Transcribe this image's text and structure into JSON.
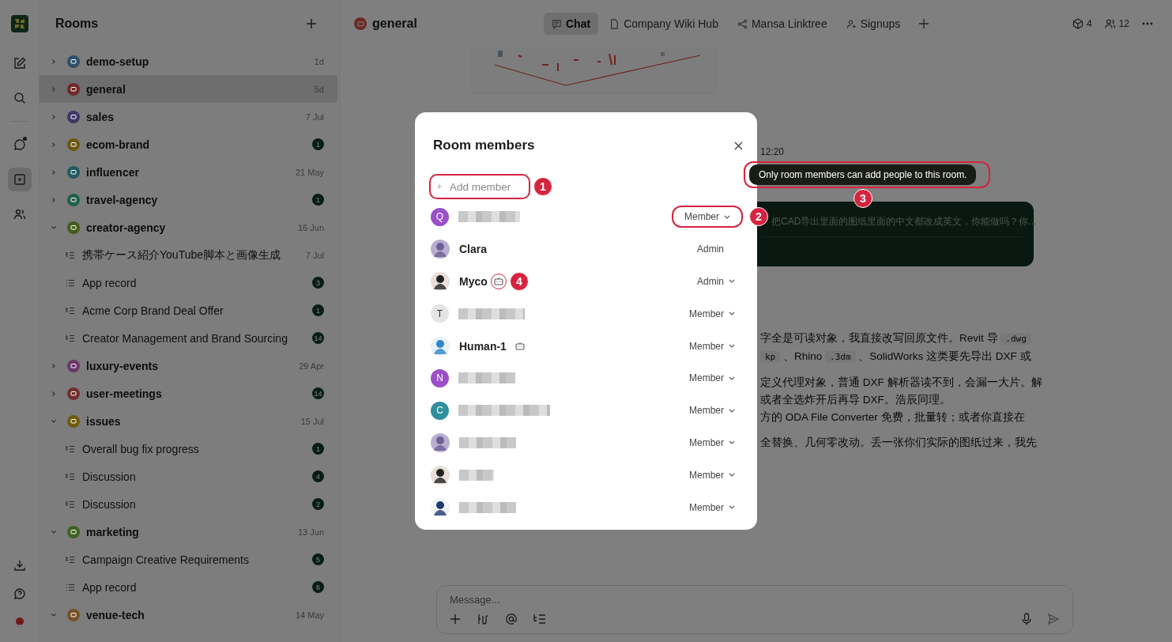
{
  "rail": {
    "items": [
      {
        "kind": "compose",
        "selected": false,
        "unread": false
      },
      {
        "kind": "search",
        "selected": false,
        "unread": false
      },
      {
        "kind": "chat",
        "selected": false,
        "unread": true
      },
      {
        "kind": "rooms",
        "selected": true,
        "unread": false
      },
      {
        "kind": "people",
        "selected": false,
        "unread": false
      }
    ],
    "bottom": [
      {
        "kind": "download"
      },
      {
        "kind": "help"
      },
      {
        "kind": "avatar"
      }
    ]
  },
  "sidebar": {
    "title": "Rooms",
    "rooms": [
      {
        "name": "demo-setup",
        "color": "#2e4e6b",
        "expanded": false,
        "selected": false,
        "meta": {
          "kind": "date",
          "text": "1d"
        }
      },
      {
        "name": "general",
        "color": "#6d2a28",
        "expanded": false,
        "selected": true,
        "meta": {
          "kind": "date",
          "text": "5d"
        }
      },
      {
        "name": "sales",
        "color": "#3e3868",
        "expanded": false,
        "selected": false,
        "meta": {
          "kind": "date",
          "text": "7 Jul"
        }
      },
      {
        "name": "ecom-brand",
        "color": "#6a5810",
        "expanded": false,
        "selected": false,
        "meta": {
          "kind": "count",
          "text": "1"
        }
      },
      {
        "name": "influencer",
        "color": "#205c62",
        "expanded": false,
        "selected": false,
        "meta": {
          "kind": "date",
          "text": "21 May"
        }
      },
      {
        "name": "travel-agency",
        "color": "#20604b",
        "expanded": false,
        "selected": false,
        "meta": {
          "kind": "count",
          "text": "1"
        }
      },
      {
        "name": "creator-agency",
        "color": "#435c1d",
        "expanded": true,
        "selected": false,
        "meta": {
          "kind": "date",
          "text": "16 Jun"
        },
        "children": [
          {
            "name": "携帯ケース紹介YouTube脚本と画像生成",
            "kind": "thread",
            "meta": {
              "kind": "date",
              "text": "7 Jul"
            }
          },
          {
            "name": "App record",
            "kind": "list",
            "meta": {
              "kind": "count",
              "text": "3"
            }
          },
          {
            "name": "Acme Corp Brand Deal Offer",
            "kind": "thread",
            "meta": {
              "kind": "count",
              "text": "1"
            }
          },
          {
            "name": "Creator Management and Brand Sourcing",
            "kind": "thread",
            "meta": {
              "kind": "count",
              "text": "14"
            }
          }
        ]
      },
      {
        "name": "luxury-events",
        "color": "#6c3668",
        "expanded": false,
        "selected": false,
        "meta": {
          "kind": "date",
          "text": "29 Apr"
        }
      },
      {
        "name": "user-meetings",
        "color": "#70302d",
        "expanded": false,
        "selected": false,
        "meta": {
          "kind": "count",
          "text": "14"
        }
      },
      {
        "name": "issues",
        "color": "#6d5b0e",
        "expanded": true,
        "selected": false,
        "meta": {
          "kind": "date",
          "text": "15 Jul"
        },
        "children": [
          {
            "name": "Overall bug fix progress",
            "kind": "thread",
            "meta": {
              "kind": "count",
              "text": "1"
            }
          },
          {
            "name": "Discussion",
            "kind": "thread",
            "meta": {
              "kind": "count",
              "text": "4"
            }
          },
          {
            "name": "Discussion",
            "kind": "thread",
            "meta": {
              "kind": "count",
              "text": "2"
            }
          }
        ]
      },
      {
        "name": "marketing",
        "color": "#3e6222",
        "expanded": true,
        "selected": false,
        "meta": {
          "kind": "date",
          "text": "13 Jun"
        },
        "children": [
          {
            "name": "Campaign Creative Requirements",
            "kind": "thread",
            "meta": {
              "kind": "count",
              "text": "5"
            }
          },
          {
            "name": "App record",
            "kind": "list",
            "meta": {
              "kind": "count",
              "text": "6"
            }
          }
        ]
      },
      {
        "name": "venue-tech",
        "color": "#785028",
        "expanded": true,
        "selected": false,
        "meta": {
          "kind": "date",
          "text": "14 May"
        }
      }
    ]
  },
  "header": {
    "room": "general",
    "tabs": [
      {
        "label": "Chat",
        "selected": true
      },
      {
        "label": "Company Wiki Hub",
        "selected": false
      },
      {
        "label": "Mansa Linktree",
        "selected": false
      },
      {
        "label": "Signups",
        "selected": false
      }
    ],
    "stats": [
      {
        "kind": "cube",
        "text": "4"
      },
      {
        "kind": "people",
        "text": "12"
      }
    ]
  },
  "chat": {
    "time": "12:20",
    "bubble": "把CAD导出里面的图纸里面的中文都改成英文，你能做吗？你...",
    "lines": [
      [
        {
          "kind": "text",
          "text": "字全是可读对象，我直接改写回原文件。Revit 导 "
        },
        {
          "kind": "code",
          "text": ".dwg"
        }
      ],
      [
        {
          "kind": "code",
          "text": "kp"
        },
        {
          "kind": "text",
          "text": " 、Rhino "
        },
        {
          "kind": "code",
          "text": ".3dm"
        },
        {
          "kind": "text",
          "text": " 、SolidWorks 这类要先导出 DXF 或"
        }
      ],
      [
        {
          "kind": "gap"
        }
      ],
      [
        {
          "kind": "text",
          "text": "定义代理对象，普通 DXF 解析器读不到，会漏一大片。解"
        }
      ],
      [
        {
          "kind": "text",
          "text": "或者全选炸开后再导 DXF。浩辰同理。"
        }
      ],
      [
        {
          "kind": "text",
          "text": "方的 ODA File Converter 免费，批量转；或者你直接在"
        }
      ],
      [
        {
          "kind": "gap"
        }
      ],
      [
        {
          "kind": "text",
          "text": "全替换、几何零改动。丢一张你们实际的图纸过来，我先"
        }
      ]
    ],
    "composer": {
      "placeholder": "Message..."
    }
  },
  "modal": {
    "title": "Room members",
    "add": {
      "placeholder": "Add member",
      "annotation": "1"
    },
    "members": [
      {
        "avatar": {
          "kind": "letter",
          "letter": "Q",
          "color": "#9b4fc8"
        },
        "bot": false,
        "role": {
          "text": "Member",
          "dropdown": true,
          "annotation": "2"
        }
      },
      {
        "name": "Clara",
        "bot": false,
        "role": {
          "text": "Admin",
          "dropdown": false
        }
      },
      {
        "name": "Myco",
        "bot": true,
        "bot_annotation": "4",
        "role": {
          "text": "Admin",
          "dropdown": true
        }
      },
      {
        "avatar": {
          "kind": "letter",
          "letter": "T",
          "color": "#e4e4e4"
        },
        "bot": false,
        "role": {
          "text": "Member",
          "dropdown": true
        }
      },
      {
        "name": "Human-1",
        "bot": true,
        "role": {
          "text": "Member",
          "dropdown": true
        }
      },
      {
        "avatar": {
          "kind": "letter",
          "letter": "N",
          "color": "#9b4fc8"
        },
        "bot": false,
        "role": {
          "text": "Member",
          "dropdown": true
        }
      },
      {
        "avatar": {
          "kind": "letter",
          "letter": "C",
          "color": "#2f8f9d"
        },
        "bot": false,
        "role": {
          "text": "Member",
          "dropdown": true
        }
      },
      {
        "bot": false,
        "role": {
          "text": "Member",
          "dropdown": true
        }
      },
      {
        "bot": false,
        "role": {
          "text": "Member",
          "dropdown": true
        }
      },
      {
        "bot": false,
        "role": {
          "text": "Member",
          "dropdown": true
        }
      }
    ]
  },
  "tooltip": {
    "text": "Only room members can add people to this room.",
    "annotation": "3"
  }
}
